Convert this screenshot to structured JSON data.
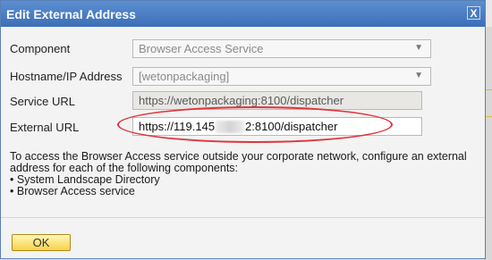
{
  "dialog": {
    "title": "Edit External Address",
    "close_label": "X"
  },
  "form": {
    "component": {
      "label": "Component",
      "value": "Browser Access Service"
    },
    "hostname": {
      "label": "Hostname/IP Address",
      "value": "[wetonpackaging]"
    },
    "service_url": {
      "label": "Service URL",
      "value": "https://wetonpackaging:8100/dispatcher"
    },
    "external_url": {
      "label": "External URL",
      "value_prefix": "https://119.145",
      "value_suffix": "2:8100/dispatcher"
    }
  },
  "info": {
    "text": "To access the Browser Access service outside your corporate network, configure an external address for each of the following components:",
    "items": [
      "System Landscape Directory",
      "Browser Access service"
    ]
  },
  "buttons": {
    "ok": "OK"
  },
  "colors": {
    "titlebar": "#4a7cc1",
    "ok_button": "#f7d24a",
    "highlight_ellipse": "#e0353a"
  }
}
